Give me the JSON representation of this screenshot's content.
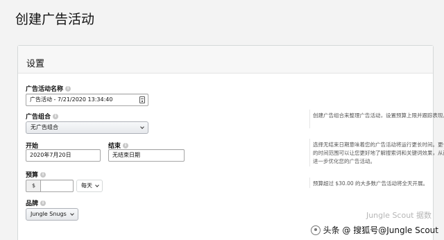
{
  "page": {
    "title": "创建广告活动"
  },
  "settings": {
    "title": "设置",
    "campaign_name": {
      "label": "广告活动名称",
      "value": "广告活动 - 7/21/2020 13:34:40"
    },
    "ad_group": {
      "label": "广告组合",
      "value": "无广告组合",
      "help": "创建广告组合来整理广告活动，设置预算上限并跟踪表现。"
    },
    "start": {
      "label": "开始",
      "value": "2020年7月20日"
    },
    "end": {
      "label": "结束",
      "value": "无结束日期",
      "help": "选择无结束日期意味着您的广告活动将运行更长时间。更长的时间范围可以让您更好地了解搜索词和关键词效果，从而进一步优化您的广告活动。"
    },
    "budget": {
      "label": "预算",
      "currency": "$",
      "value": "",
      "period": "每天",
      "help": "预算超过 $30.00 的大多数广告活动将全天开展。"
    },
    "brand": {
      "label": "品牌",
      "value": "Jungle Snugs"
    }
  },
  "icons": {
    "info": "info-icon",
    "calendar": "calendar-icon",
    "dropdown": "chevron-down-icon"
  },
  "watermark": {
    "brand": "Jungle Scout 据数",
    "text": "头条 @ 搜狐号@Jungle Scout"
  }
}
